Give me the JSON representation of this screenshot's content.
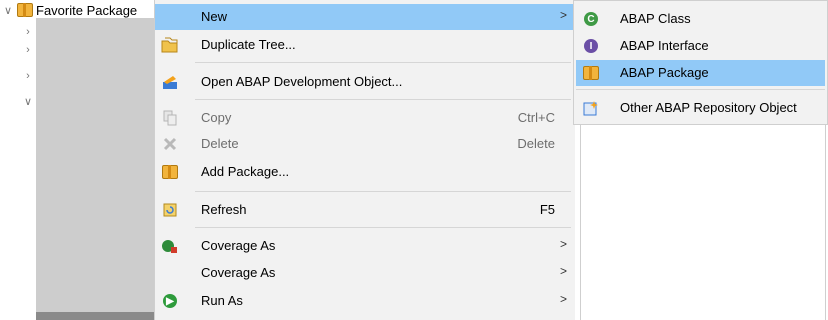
{
  "tree": {
    "root_label": "Favorite Package",
    "root_chevron": "∨",
    "child_chevrons": [
      "›",
      "›",
      "›",
      "∨"
    ]
  },
  "context_menu": {
    "items": [
      {
        "label": "New",
        "has_submenu": true,
        "icon": "none",
        "highlighted": true
      },
      {
        "label": "Duplicate Tree...",
        "icon": "duplicate-folder-icon"
      },
      {
        "label": "Open ABAP Development Object...",
        "icon": "open-object-icon"
      },
      {
        "label": "Copy",
        "shortcut": "Ctrl+C",
        "icon": "copy-icon",
        "disabled": true
      },
      {
        "label": "Delete",
        "shortcut": "Delete",
        "icon": "delete-icon",
        "disabled": true
      },
      {
        "label": "Add Package...",
        "icon": "package-icon"
      },
      {
        "label": "Refresh",
        "shortcut": "F5",
        "icon": "refresh-icon"
      },
      {
        "label": "Coverage As",
        "has_submenu": true,
        "icon": "coverage-icon"
      },
      {
        "label": "Coverage As",
        "has_submenu": true,
        "icon": "none"
      },
      {
        "label": "Run As",
        "has_submenu": true,
        "icon": "run-icon"
      }
    ],
    "submenu_arrow": ">"
  },
  "submenu": {
    "items": [
      {
        "label": "ABAP Class",
        "icon": "abap-class-icon"
      },
      {
        "label": "ABAP Interface",
        "icon": "abap-interface-icon"
      },
      {
        "label": "ABAP Package",
        "icon": "abap-package-icon",
        "highlighted": true
      },
      {
        "label": "Other ABAP Repository Object",
        "icon": "repository-object-icon"
      }
    ]
  },
  "colors": {
    "highlight": "#91c9f7",
    "menu_bg": "#f2f2f2",
    "disabled_text": "#6d6d6d"
  }
}
